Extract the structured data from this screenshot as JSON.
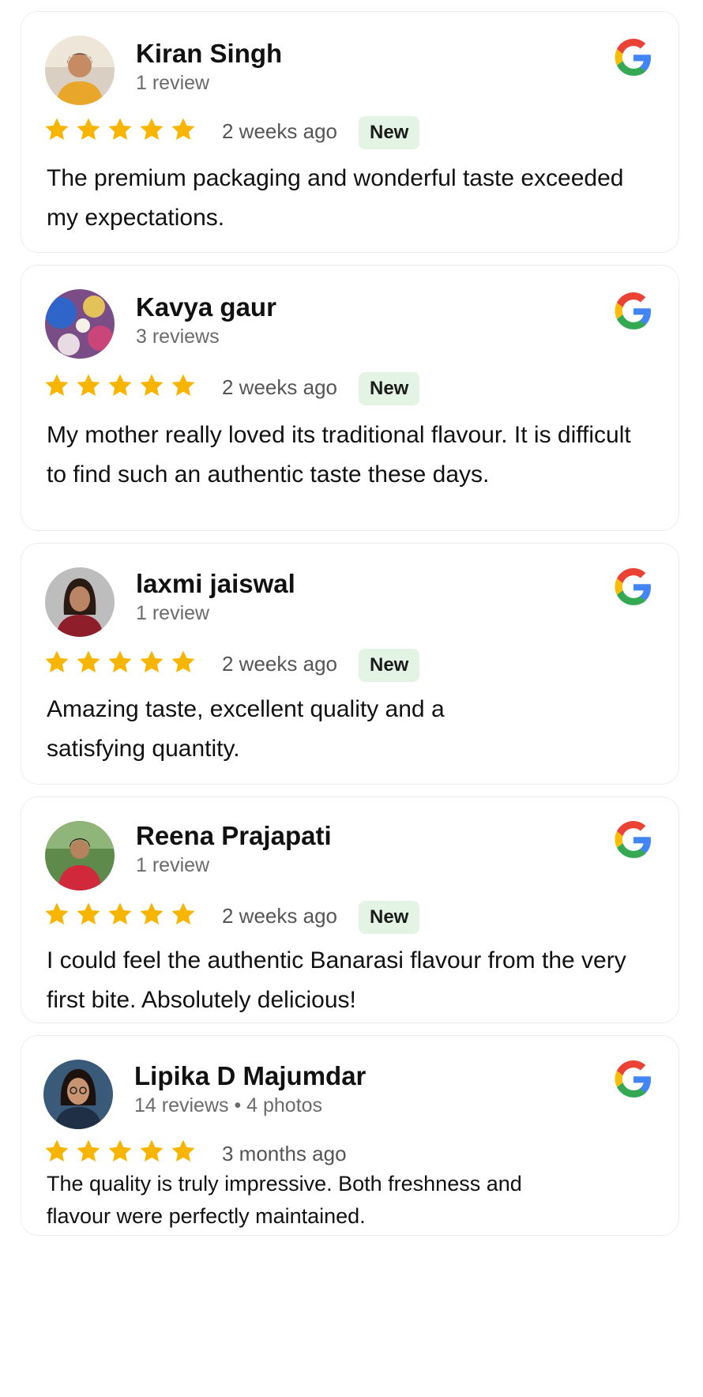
{
  "colors": {
    "star": "#f7b500",
    "badge_bg": "#e3f4e5",
    "google_blue": "#4285F4",
    "google_red": "#EA4335",
    "google_yellow": "#FBBC05",
    "google_green": "#34A853"
  },
  "reviews": [
    {
      "name": "Kiran Singh",
      "meta": "1 review",
      "rating": 5,
      "time": "2 weeks ago",
      "badge": "New",
      "text": "The premium packaging and wonderful taste exceeded my expectations.",
      "source_icon": "google-logo-icon"
    },
    {
      "name": "Kavya gaur",
      "meta": "3 reviews",
      "rating": 5,
      "time": "2 weeks ago",
      "badge": "New",
      "text": "My mother really loved its traditional flavour. It is difficult to find such an authentic taste these days.",
      "source_icon": "google-logo-icon"
    },
    {
      "name": "laxmi jaiswal",
      "meta": "1 review",
      "rating": 5,
      "time": "2 weeks ago",
      "badge": "New",
      "text": "Amazing taste, excellent quality and a satisfying quantity.",
      "source_icon": "google-logo-icon"
    },
    {
      "name": "Reena Prajapati",
      "meta": "1 review",
      "rating": 5,
      "time": "2 weeks ago",
      "badge": "New",
      "text": "I could feel the authentic Banarasi flavour from the very first bite. Absolutely delicious!",
      "source_icon": "google-logo-icon"
    },
    {
      "name": "Lipika D Majumdar",
      "meta": "14 reviews • 4 photos",
      "rating": 5,
      "time": "3 months ago",
      "badge": "",
      "text": "The quality is truly impressive. Both freshness and flavour were perfectly maintained.",
      "source_icon": "google-logo-icon"
    }
  ]
}
